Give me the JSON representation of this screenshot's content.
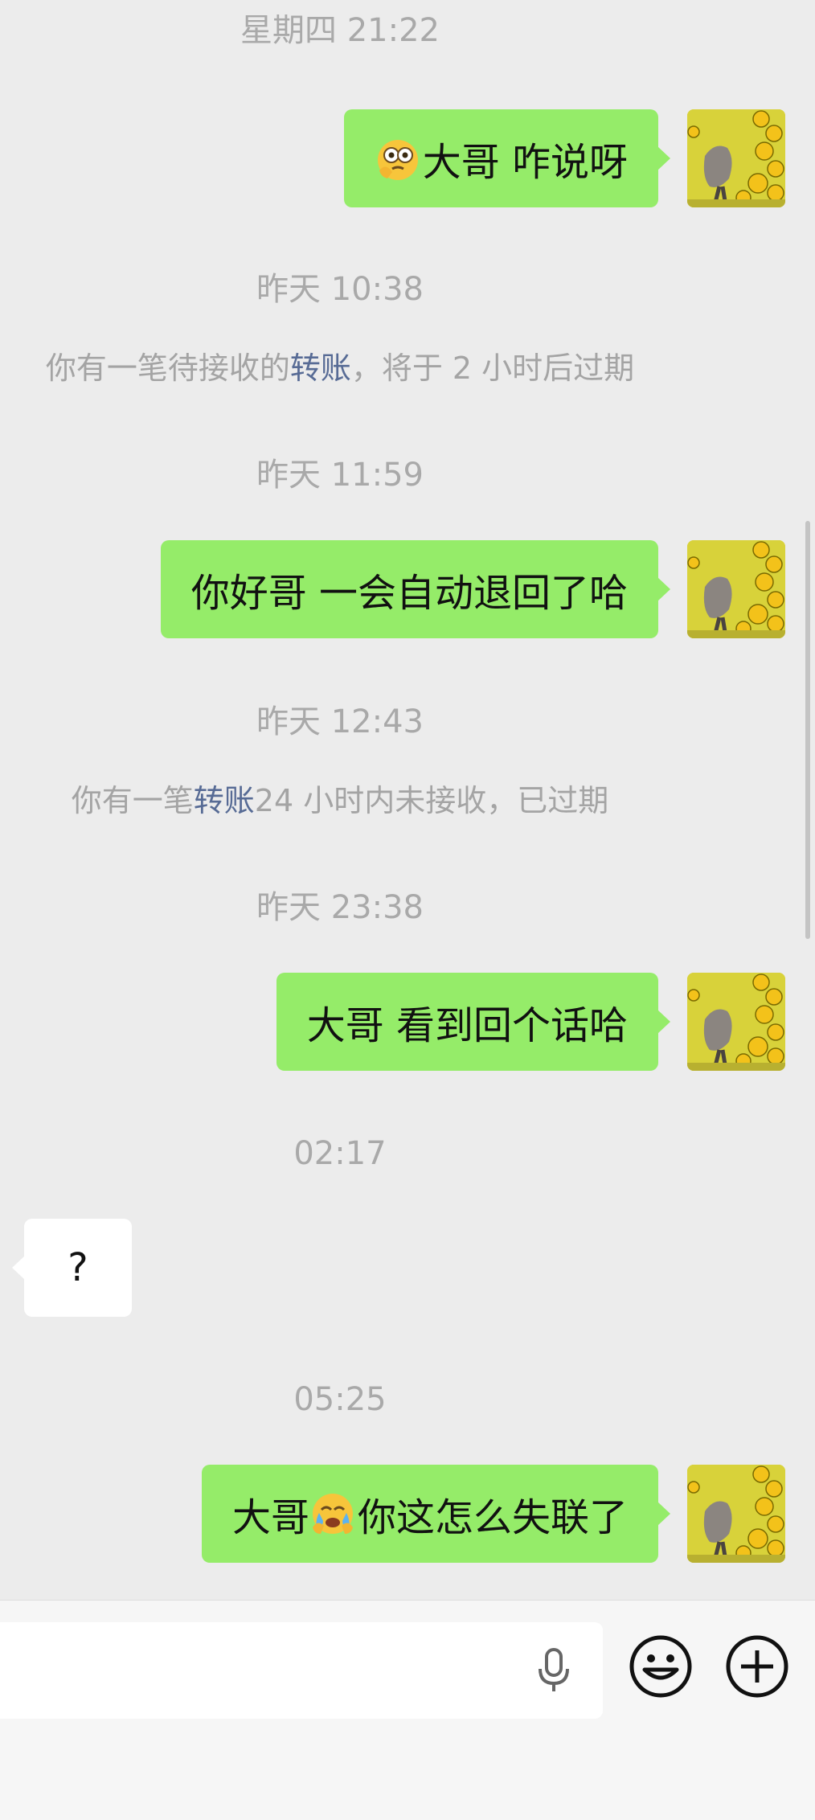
{
  "chat": {
    "messages": [
      {
        "type": "timestamp",
        "text": "星期四 21:22"
      },
      {
        "type": "sent",
        "emoji": "monocle-face-emoji",
        "text": "大哥 咋说呀"
      },
      {
        "type": "timestamp",
        "text": "昨天 10:38"
      },
      {
        "type": "system",
        "before": "你有一笔待接收的",
        "link": "转账",
        "after": "，将于 2 小时后过期"
      },
      {
        "type": "timestamp",
        "text": "昨天 11:59"
      },
      {
        "type": "sent",
        "text": "你好哥 一会自动退回了哈"
      },
      {
        "type": "timestamp",
        "text": "昨天 12:43"
      },
      {
        "type": "system",
        "before": "你有一笔",
        "link": "转账",
        "after": "24 小时内未接收，已过期"
      },
      {
        "type": "timestamp",
        "text": "昨天 23:38"
      },
      {
        "type": "sent",
        "text": "大哥 看到回个话哈"
      },
      {
        "type": "timestamp",
        "text": "02:17"
      },
      {
        "type": "received",
        "text": "?"
      },
      {
        "type": "timestamp",
        "text": "05:25"
      },
      {
        "type": "sent",
        "before": "大哥",
        "emoji": "crying-face-emoji",
        "after": "你这怎么失联了"
      }
    ]
  },
  "input_bar": {
    "icons": [
      "microphone-icon",
      "smiley-icon",
      "plus-icon"
    ]
  },
  "colors": {
    "background": "#ececec",
    "sent_bubble": "#95ec69",
    "received_bubble": "#ffffff",
    "timestamp_text": "#a9a9a9",
    "link": "#576b95"
  }
}
